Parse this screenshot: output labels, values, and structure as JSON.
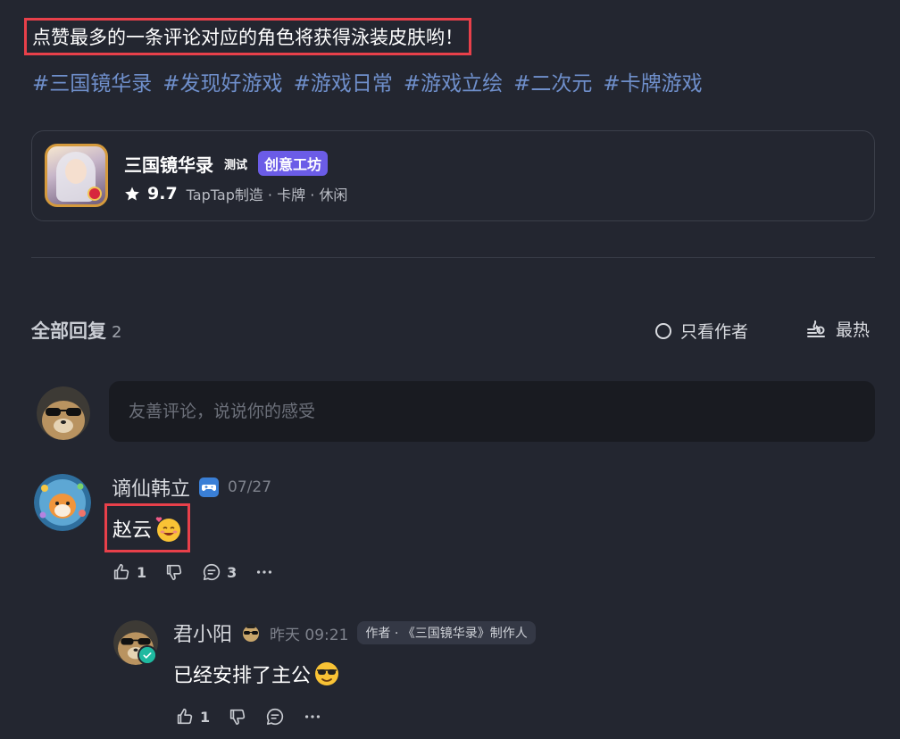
{
  "post": {
    "headline": "点赞最多的一条评论对应的角色将获得泳装皮肤哟！",
    "tags": [
      "#三国镜华录",
      "#发现好游戏",
      "#游戏日常",
      "#游戏立绘",
      "#二次元",
      "#卡牌游戏"
    ]
  },
  "game_card": {
    "name": "三国镜华录",
    "test_badge": "测试",
    "workshop_badge": "创意工坊",
    "rating": "9.7",
    "meta": "TapTap制造 · 卡牌 · 休闲",
    "icon": "game-character-portrait"
  },
  "replies_header": {
    "title": "全部回复",
    "count": "2",
    "author_only_label": "只看作者",
    "sort_label": "最热"
  },
  "composer": {
    "placeholder": "友善评论，说说你的感受"
  },
  "comments": [
    {
      "username": "谪仙韩立",
      "badge_icon": "gamepad-icon",
      "date": "07/27",
      "text": "赵云",
      "emoji": "blushing-heart-emoji",
      "likes": "1",
      "replies": "3",
      "reply": {
        "username": "君小阳",
        "badge_icon": "pug-sunglasses-icon",
        "date": "昨天 09:21",
        "author_tag": "作者 · 《三国镜华录》制作人",
        "text": "已经安排了主公",
        "emoji": "sunglasses-emoji",
        "likes": "1"
      }
    }
  ],
  "colors": {
    "background": "#232630",
    "highlight_border": "#e8404a",
    "tag_blue": "#6f8fcb",
    "workshop_purple": "#6b5ce7",
    "verified_teal": "#1fb9a0"
  }
}
